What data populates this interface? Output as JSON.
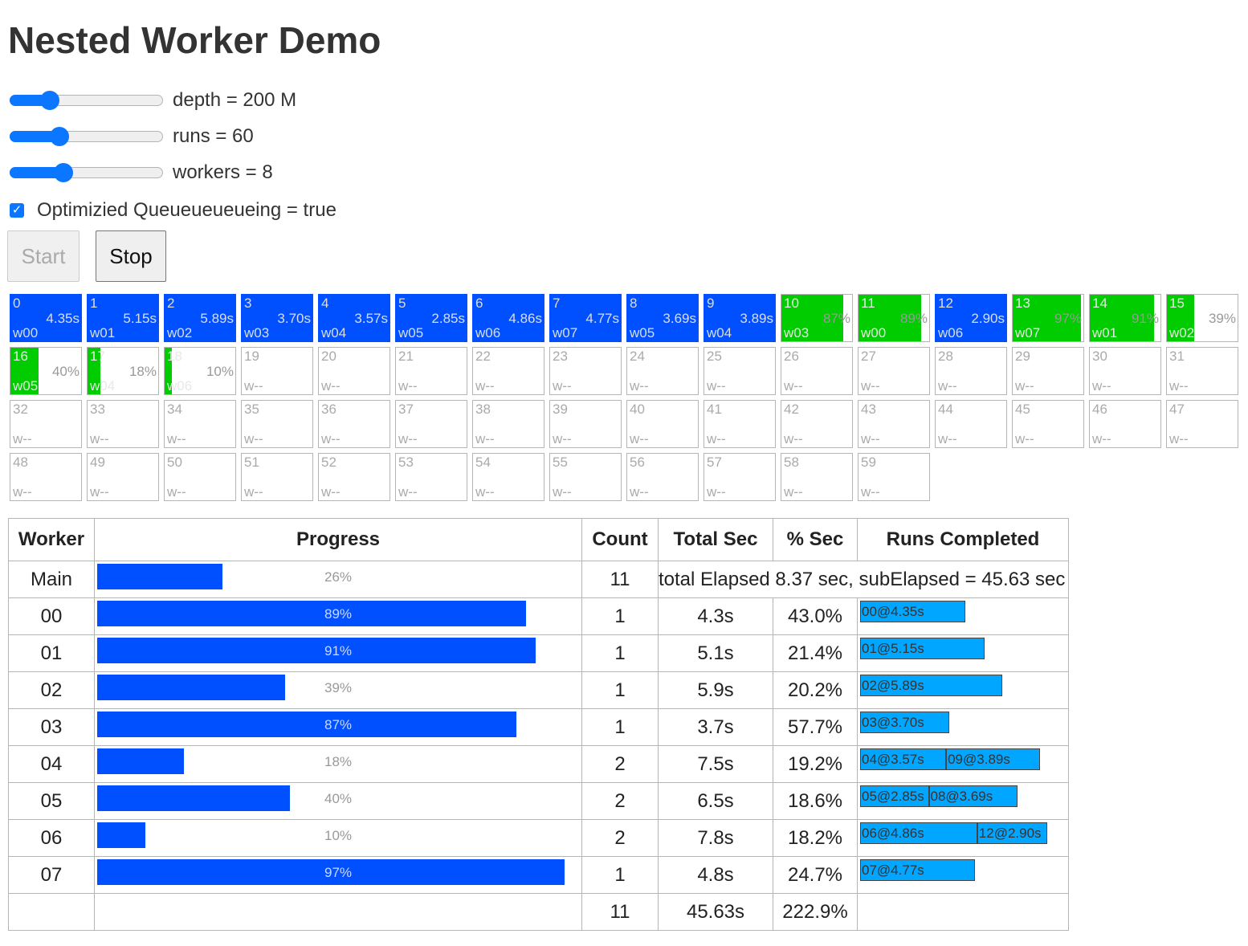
{
  "title": "Nested Worker Demo",
  "controls": {
    "depth_label": "depth = 200 M",
    "depth_fraction": 0.23,
    "runs_label": "runs = 60",
    "runs_fraction": 0.3,
    "workers_label": "workers = 8",
    "workers_fraction": 0.33,
    "optimized_label": "Optimizied Queueueueueing = true",
    "optimized_checked": true,
    "start_label": "Start",
    "start_disabled": true,
    "stop_label": "Stop"
  },
  "colors": {
    "done": "#0050ff",
    "running": "#00cc00",
    "segment": "#00a6ff"
  },
  "runs": [
    {
      "num": "0",
      "time": "4.35s",
      "worker": "w00",
      "state": "done"
    },
    {
      "num": "1",
      "time": "5.15s",
      "worker": "w01",
      "state": "done"
    },
    {
      "num": "2",
      "time": "5.89s",
      "worker": "w02",
      "state": "done"
    },
    {
      "num": "3",
      "time": "3.70s",
      "worker": "w03",
      "state": "done"
    },
    {
      "num": "4",
      "time": "3.57s",
      "worker": "w04",
      "state": "done"
    },
    {
      "num": "5",
      "time": "2.85s",
      "worker": "w05",
      "state": "done"
    },
    {
      "num": "6",
      "time": "4.86s",
      "worker": "w06",
      "state": "done"
    },
    {
      "num": "7",
      "time": "4.77s",
      "worker": "w07",
      "state": "done"
    },
    {
      "num": "8",
      "time": "3.69s",
      "worker": "w05",
      "state": "done"
    },
    {
      "num": "9",
      "time": "3.89s",
      "worker": "w04",
      "state": "done"
    },
    {
      "num": "10",
      "time": "87%",
      "worker": "w03",
      "state": "running",
      "progress": 0.87
    },
    {
      "num": "11",
      "time": "89%",
      "worker": "w00",
      "state": "running",
      "progress": 0.89
    },
    {
      "num": "12",
      "time": "2.90s",
      "worker": "w06",
      "state": "done"
    },
    {
      "num": "13",
      "time": "97%",
      "worker": "w07",
      "state": "running",
      "progress": 0.97
    },
    {
      "num": "14",
      "time": "91%",
      "worker": "w01",
      "state": "running",
      "progress": 0.91
    },
    {
      "num": "15",
      "time": "39%",
      "worker": "w02",
      "state": "running",
      "progress": 0.39
    },
    {
      "num": "16",
      "time": "40%",
      "worker": "w05",
      "state": "running",
      "progress": 0.4
    },
    {
      "num": "17",
      "time": "18%",
      "worker": "w04",
      "state": "running",
      "progress": 0.18
    },
    {
      "num": "18",
      "time": "10%",
      "worker": "w06",
      "state": "running",
      "progress": 0.1
    },
    {
      "num": "19",
      "time": "",
      "worker": "w--",
      "state": "empty"
    },
    {
      "num": "20",
      "time": "",
      "worker": "w--",
      "state": "empty"
    },
    {
      "num": "21",
      "time": "",
      "worker": "w--",
      "state": "empty"
    },
    {
      "num": "22",
      "time": "",
      "worker": "w--",
      "state": "empty"
    },
    {
      "num": "23",
      "time": "",
      "worker": "w--",
      "state": "empty"
    },
    {
      "num": "24",
      "time": "",
      "worker": "w--",
      "state": "empty"
    },
    {
      "num": "25",
      "time": "",
      "worker": "w--",
      "state": "empty"
    },
    {
      "num": "26",
      "time": "",
      "worker": "w--",
      "state": "empty"
    },
    {
      "num": "27",
      "time": "",
      "worker": "w--",
      "state": "empty"
    },
    {
      "num": "28",
      "time": "",
      "worker": "w--",
      "state": "empty"
    },
    {
      "num": "29",
      "time": "",
      "worker": "w--",
      "state": "empty"
    },
    {
      "num": "30",
      "time": "",
      "worker": "w--",
      "state": "empty"
    },
    {
      "num": "31",
      "time": "",
      "worker": "w--",
      "state": "empty"
    },
    {
      "num": "32",
      "time": "",
      "worker": "w--",
      "state": "empty"
    },
    {
      "num": "33",
      "time": "",
      "worker": "w--",
      "state": "empty"
    },
    {
      "num": "34",
      "time": "",
      "worker": "w--",
      "state": "empty"
    },
    {
      "num": "35",
      "time": "",
      "worker": "w--",
      "state": "empty"
    },
    {
      "num": "36",
      "time": "",
      "worker": "w--",
      "state": "empty"
    },
    {
      "num": "37",
      "time": "",
      "worker": "w--",
      "state": "empty"
    },
    {
      "num": "38",
      "time": "",
      "worker": "w--",
      "state": "empty"
    },
    {
      "num": "39",
      "time": "",
      "worker": "w--",
      "state": "empty"
    },
    {
      "num": "40",
      "time": "",
      "worker": "w--",
      "state": "empty"
    },
    {
      "num": "41",
      "time": "",
      "worker": "w--",
      "state": "empty"
    },
    {
      "num": "42",
      "time": "",
      "worker": "w--",
      "state": "empty"
    },
    {
      "num": "43",
      "time": "",
      "worker": "w--",
      "state": "empty"
    },
    {
      "num": "44",
      "time": "",
      "worker": "w--",
      "state": "empty"
    },
    {
      "num": "45",
      "time": "",
      "worker": "w--",
      "state": "empty"
    },
    {
      "num": "46",
      "time": "",
      "worker": "w--",
      "state": "empty"
    },
    {
      "num": "47",
      "time": "",
      "worker": "w--",
      "state": "empty"
    },
    {
      "num": "48",
      "time": "",
      "worker": "w--",
      "state": "empty"
    },
    {
      "num": "49",
      "time": "",
      "worker": "w--",
      "state": "empty"
    },
    {
      "num": "50",
      "time": "",
      "worker": "w--",
      "state": "empty"
    },
    {
      "num": "51",
      "time": "",
      "worker": "w--",
      "state": "empty"
    },
    {
      "num": "52",
      "time": "",
      "worker": "w--",
      "state": "empty"
    },
    {
      "num": "53",
      "time": "",
      "worker": "w--",
      "state": "empty"
    },
    {
      "num": "54",
      "time": "",
      "worker": "w--",
      "state": "empty"
    },
    {
      "num": "55",
      "time": "",
      "worker": "w--",
      "state": "empty"
    },
    {
      "num": "56",
      "time": "",
      "worker": "w--",
      "state": "empty"
    },
    {
      "num": "57",
      "time": "",
      "worker": "w--",
      "state": "empty"
    },
    {
      "num": "58",
      "time": "",
      "worker": "w--",
      "state": "empty"
    },
    {
      "num": "59",
      "time": "",
      "worker": "w--",
      "state": "empty"
    }
  ],
  "table": {
    "headers": [
      "Worker",
      "Progress",
      "Count",
      "Total Sec",
      "% Sec",
      "Runs Completed"
    ],
    "main": {
      "worker": "Main",
      "progress": 0.26,
      "progress_text": "26%",
      "count": "11",
      "summary": "total Elapsed 8.37 sec, subElapsed = 45.63 sec"
    },
    "rows": [
      {
        "worker": "00",
        "progress": 0.89,
        "progress_text": "89%",
        "count": "1",
        "total": "4.3s",
        "pct": "43.0%",
        "runs": [
          {
            "label": "00@4.35s",
            "secs": 4.35
          }
        ]
      },
      {
        "worker": "01",
        "progress": 0.91,
        "progress_text": "91%",
        "count": "1",
        "total": "5.1s",
        "pct": "21.4%",
        "runs": [
          {
            "label": "01@5.15s",
            "secs": 5.15
          }
        ]
      },
      {
        "worker": "02",
        "progress": 0.39,
        "progress_text": "39%",
        "count": "1",
        "total": "5.9s",
        "pct": "20.2%",
        "runs": [
          {
            "label": "02@5.89s",
            "secs": 5.89
          }
        ]
      },
      {
        "worker": "03",
        "progress": 0.87,
        "progress_text": "87%",
        "count": "1",
        "total": "3.7s",
        "pct": "57.7%",
        "runs": [
          {
            "label": "03@3.70s",
            "secs": 3.7
          }
        ]
      },
      {
        "worker": "04",
        "progress": 0.18,
        "progress_text": "18%",
        "count": "2",
        "total": "7.5s",
        "pct": "19.2%",
        "runs": [
          {
            "label": "04@3.57s",
            "secs": 3.57
          },
          {
            "label": "09@3.89s",
            "secs": 3.89
          }
        ]
      },
      {
        "worker": "05",
        "progress": 0.4,
        "progress_text": "40%",
        "count": "2",
        "total": "6.5s",
        "pct": "18.6%",
        "runs": [
          {
            "label": "05@2.85s",
            "secs": 2.85
          },
          {
            "label": "08@3.69s",
            "secs": 3.69
          }
        ]
      },
      {
        "worker": "06",
        "progress": 0.1,
        "progress_text": "10%",
        "count": "2",
        "total": "7.8s",
        "pct": "18.2%",
        "runs": [
          {
            "label": "06@4.86s",
            "secs": 4.86
          },
          {
            "label": "12@2.90s",
            "secs": 2.9
          }
        ]
      },
      {
        "worker": "07",
        "progress": 0.97,
        "progress_text": "97%",
        "count": "1",
        "total": "4.8s",
        "pct": "24.7%",
        "runs": [
          {
            "label": "07@4.77s",
            "secs": 4.77
          }
        ]
      }
    ],
    "totals": {
      "count": "11",
      "total": "45.63s",
      "pct": "222.9%"
    }
  }
}
